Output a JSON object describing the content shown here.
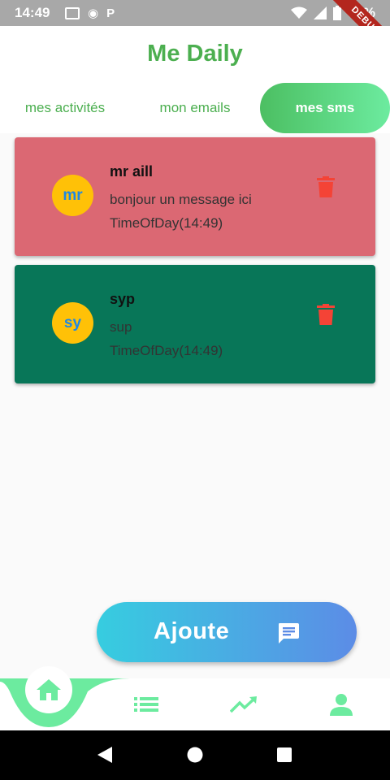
{
  "status_bar": {
    "time": "14:49",
    "battery": "99%",
    "debug_label": "DEBUG"
  },
  "app": {
    "title": "Me Daily"
  },
  "tabs": [
    {
      "label": "mes activités",
      "active": false
    },
    {
      "label": "mon emails",
      "active": false
    },
    {
      "label": "mes sms",
      "active": true
    }
  ],
  "messages": [
    {
      "initials": "mr",
      "sender": "mr aill",
      "message": "bonjour un message ici",
      "time": "TimeOfDay(14:49)",
      "color": "#db6873",
      "action_icon": "trash-icon"
    },
    {
      "initials": "sy",
      "sender": "syp",
      "message": "sup",
      "time": "TimeOfDay(14:49)",
      "color": "#087658",
      "action_icon": "trash-icon"
    }
  ],
  "fab": {
    "label": "Ajoute",
    "icon": "message-icon"
  },
  "bottom_nav": [
    {
      "icon": "home-icon",
      "active": true
    },
    {
      "icon": "list-icon",
      "active": false
    },
    {
      "icon": "trending-icon",
      "active": false
    },
    {
      "icon": "person-icon",
      "active": false
    }
  ],
  "colors": {
    "accent": "#4caf50",
    "nav_accent": "#6ceb9f",
    "trash": "#f44336",
    "avatar": "#ffc107"
  }
}
